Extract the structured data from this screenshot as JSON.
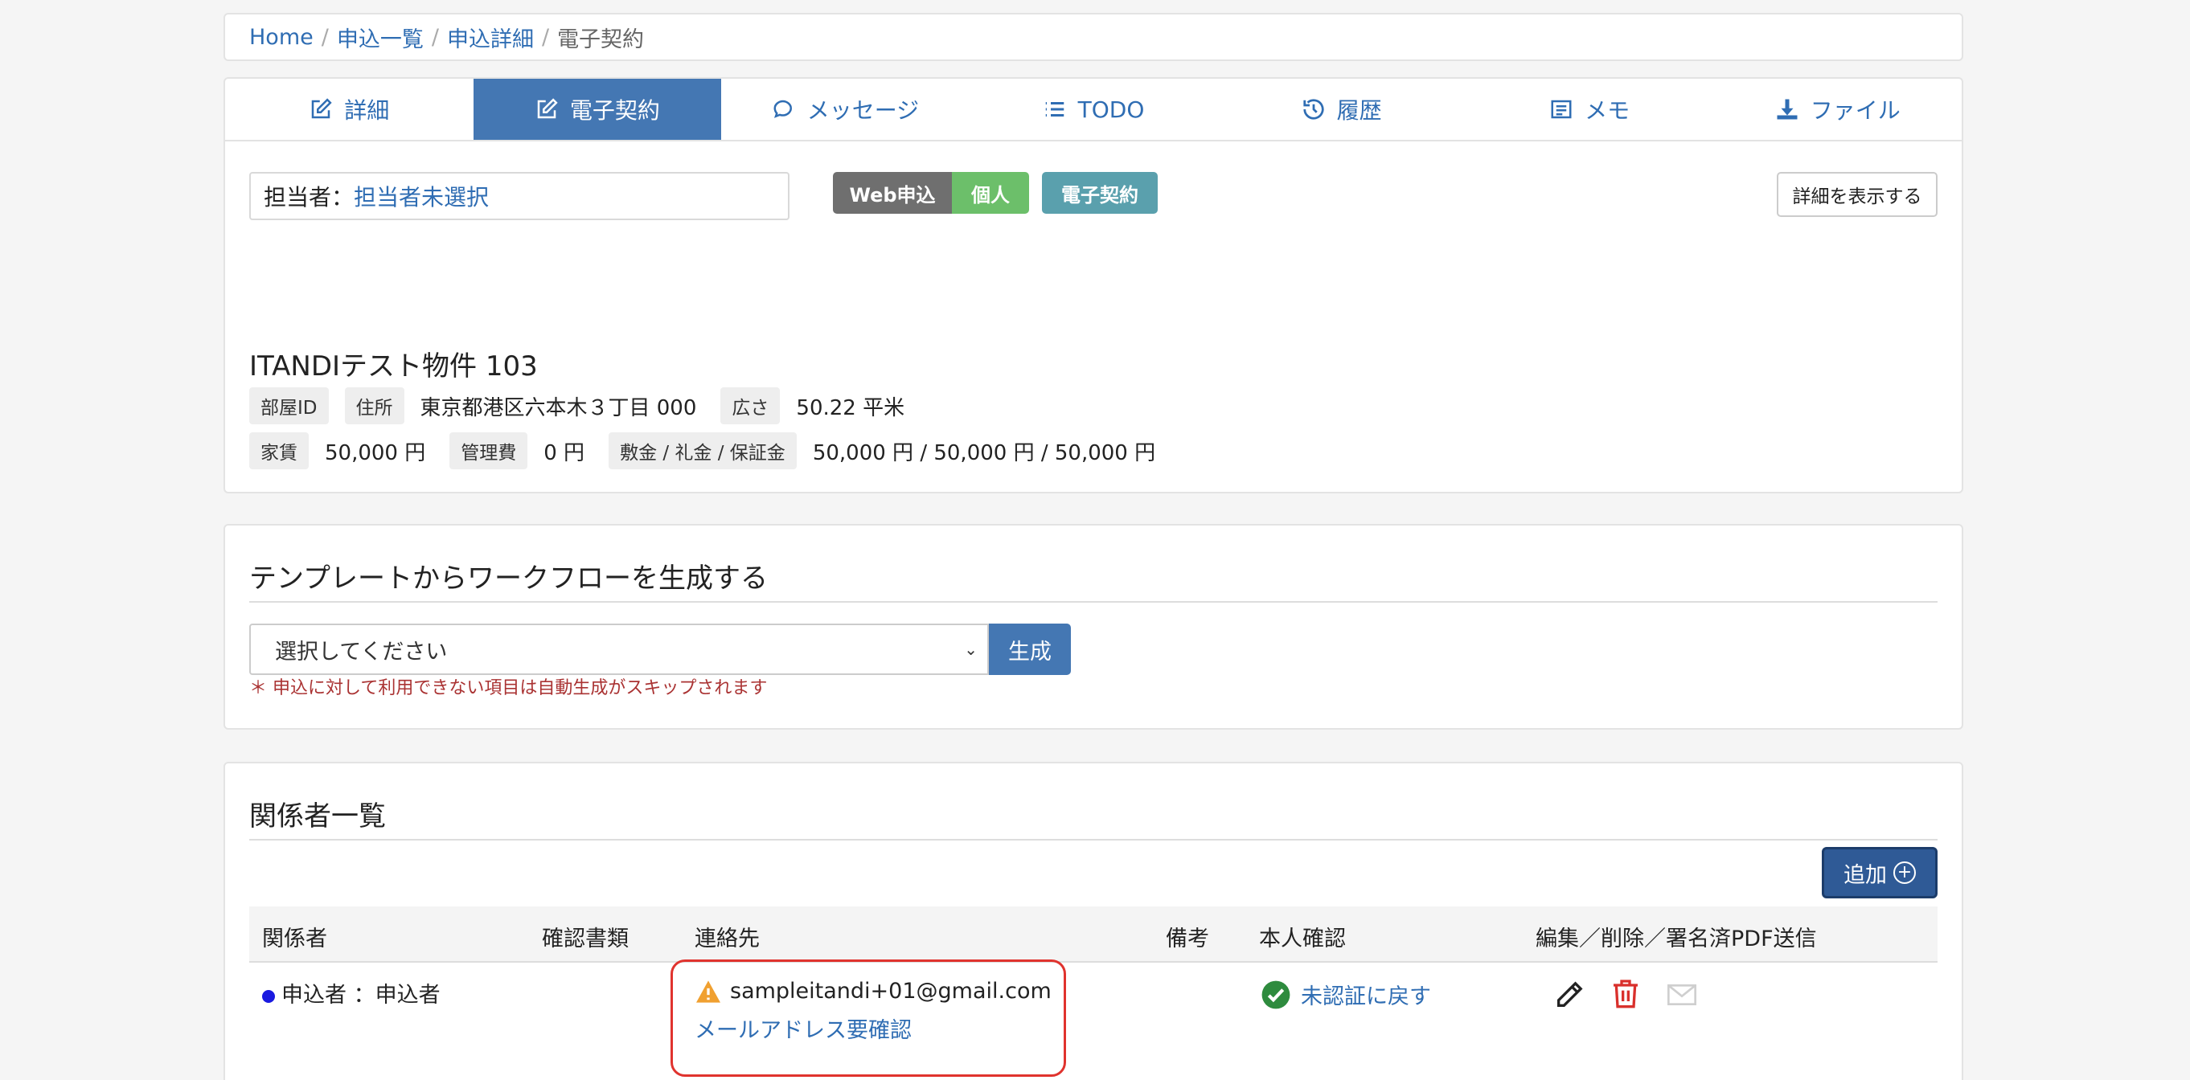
{
  "breadcrumb": {
    "home": "Home",
    "list": "申込一覧",
    "detail": "申込詳細",
    "current": "電子契約"
  },
  "tabs": [
    {
      "label": "詳細",
      "icon": "edit-icon"
    },
    {
      "label": "電子契約",
      "icon": "edit-icon",
      "active": true
    },
    {
      "label": "メッセージ",
      "icon": "chat-icon"
    },
    {
      "label": "TODO",
      "icon": "list-icon"
    },
    {
      "label": "履歴",
      "icon": "history-icon"
    },
    {
      "label": "メモ",
      "icon": "memo-icon"
    },
    {
      "label": "ファイル",
      "icon": "download-icon"
    }
  ],
  "assignee": {
    "label": "担当者：",
    "value": "担当者未選択"
  },
  "badges": {
    "web": "Web申込",
    "kojin": "個人",
    "denshi": "電子契約"
  },
  "detail_button": "詳細を表示する",
  "property": {
    "title": "ITANDIテスト物件 103",
    "room_id_label": "部屋ID",
    "address_label": "住所",
    "address": "東京都港区六本木３丁目 000",
    "area_label": "広さ",
    "area": "50.22 平米",
    "rent_label": "家賃",
    "rent": "50,000 円",
    "fee_label": "管理費",
    "fee": "0 円",
    "deposit_label": "敷金 / 礼金 / 保証金",
    "deposit": "50,000 円 / 50,000 円 / 50,000 円"
  },
  "workflow": {
    "title": "テンプレートからワークフローを生成する",
    "select_value": "選択してください",
    "generate_label": "生成",
    "note": "＊ 申込に対して利用できない項目は自動生成がスキップされます"
  },
  "parties": {
    "title": "関係者一覧",
    "add_label": "追加",
    "headers": {
      "party": "関係者",
      "docs": "確認書類",
      "contact": "連絡先",
      "remarks": "備考",
      "identity": "本人確認",
      "actions": "編集／削除／署名済PDF送信"
    },
    "rows": [
      {
        "party": "申込者 ：申込者",
        "email": "sampleitandi+01@gmail.com",
        "email_status": "メールアドレス要確認",
        "identity_action": "未認証に戻す"
      }
    ]
  },
  "colors": {
    "accent": "#4477b3",
    "link": "#2f6db3",
    "warning": "#f0a030",
    "success": "#2e8b3e",
    "danger": "#d9302c",
    "highlight": "#e0332e"
  }
}
